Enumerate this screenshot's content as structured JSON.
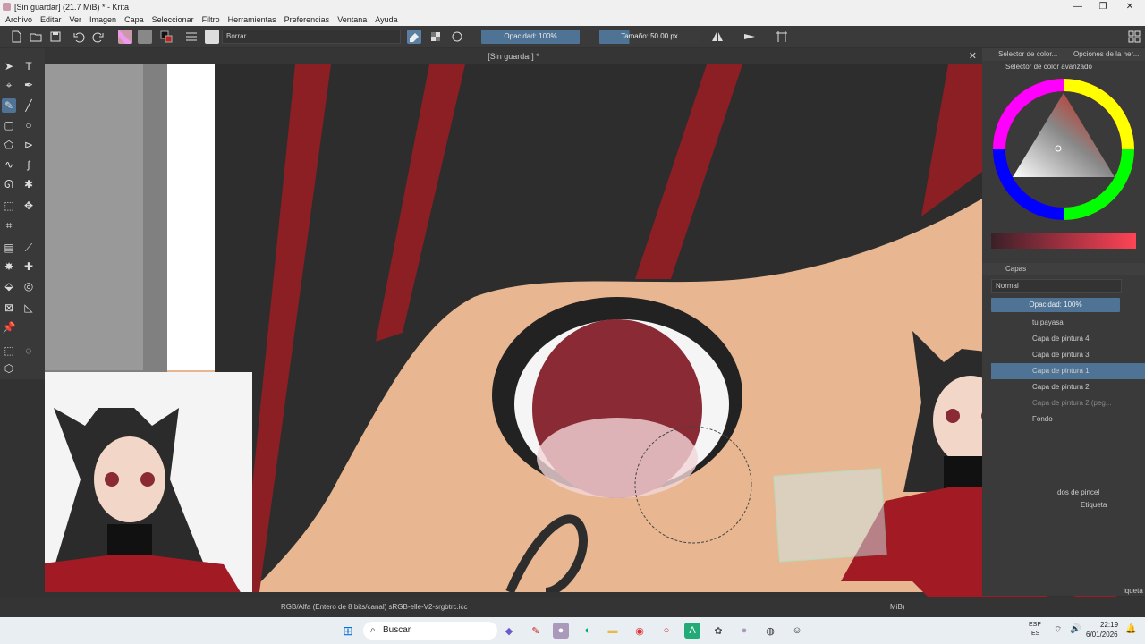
{
  "window": {
    "title": "[Sin guardar]  (21.7 MiB)  * - Krita",
    "controls": [
      "—",
      "❐",
      "✕"
    ]
  },
  "menu": [
    "Archivo",
    "Editar",
    "Ver",
    "Imagen",
    "Capa",
    "Seleccionar",
    "Filtro",
    "Herramientas",
    "Preferencias",
    "Ventana",
    "Ayuda"
  ],
  "toolbar": {
    "blend_mode": "Borrar",
    "opacity": "Opacidad: 100%",
    "size": "Tamaño: 50.00 px"
  },
  "document": {
    "tab_title": "[Sin guardar] *"
  },
  "dock": {
    "tab_color_selector": "Selector de color...",
    "tab_tool_options": "Opciones de la her...",
    "advanced_color_selector": "Selector de color avanzado",
    "layers_title": "Capas",
    "layer_blend": "Normal",
    "layer_opacity": "Opacidad: 100%",
    "layers": [
      {
        "name": "tu payasa"
      },
      {
        "name": "Capa de pintura 4"
      },
      {
        "name": "Capa de pintura 3"
      },
      {
        "name": "Capa de pintura 1"
      },
      {
        "name": "Capa de pintura 2"
      },
      {
        "name": "Capa de pintura 2 (peg..."
      },
      {
        "name": "Fondo"
      }
    ],
    "brush_presets_title": "dos de pincel",
    "tag_label": "Etiqueta",
    "tag_label_bottom": "iqueta"
  },
  "status": {
    "color_space": "RGB/Alfa (Entero de 8 bits/canal)  sRGB-elle-V2-srgbtrc.icc",
    "memory": "MiB)"
  },
  "taskbar": {
    "search": "Buscar",
    "lang_top": "ESP",
    "lang_bottom": "ES",
    "time": "22:19",
    "date": "6/01/2026"
  },
  "colors": {
    "accent": "#4f7394",
    "skin": "#e8b791",
    "hair": "#2b2b2b",
    "hair_red": "#8c1f24",
    "iris": "#8a2a35"
  }
}
